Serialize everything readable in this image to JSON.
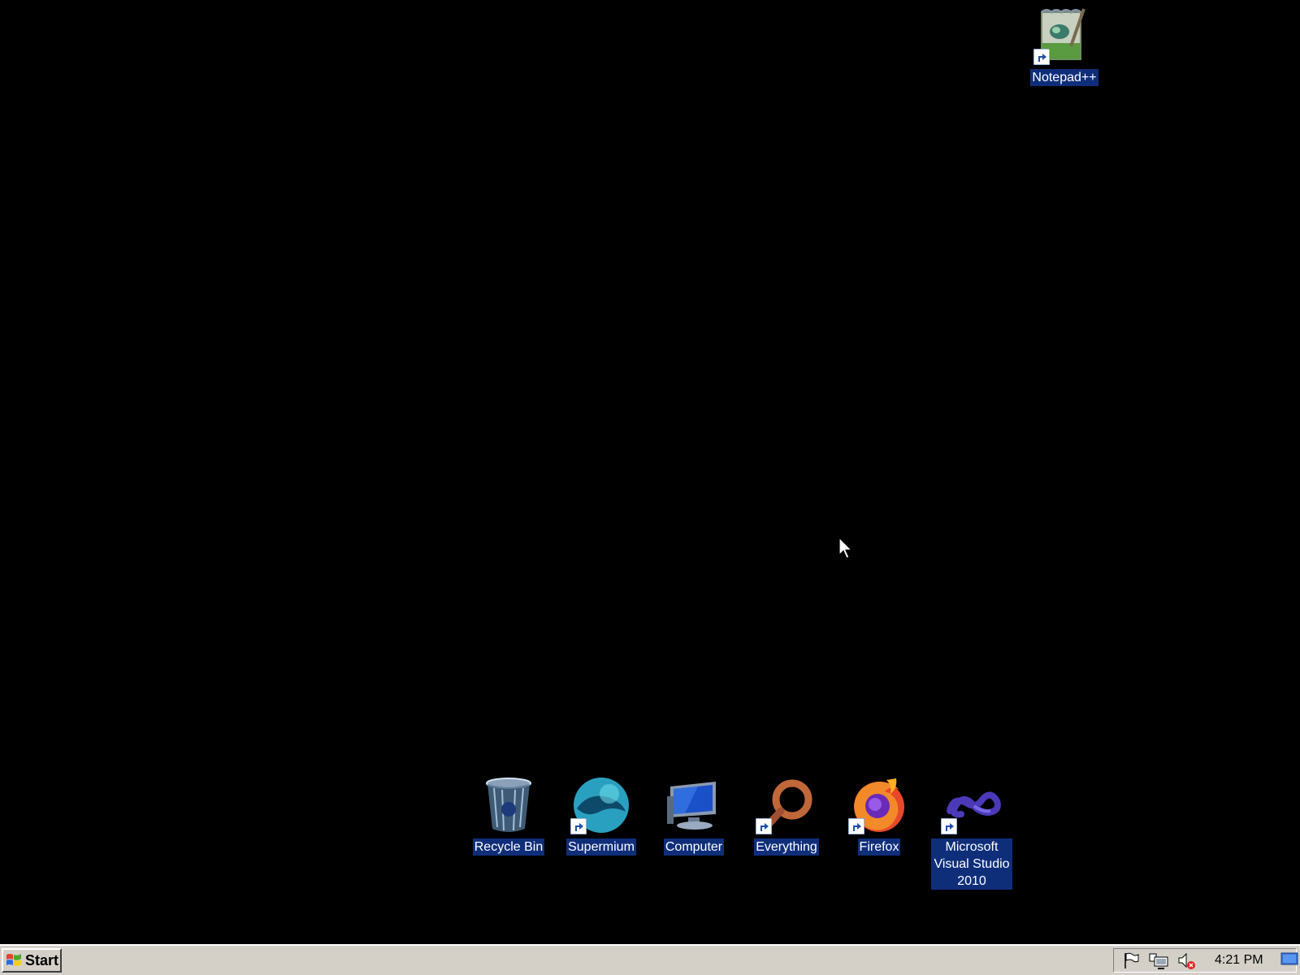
{
  "desktop": {
    "background_color": "#000000",
    "label_highlight_color": "#0f2e7a",
    "icons": [
      {
        "label": "Notepad++",
        "icon": "notepad-plus-plus-icon",
        "shortcut": true
      },
      {
        "label": "Recycle Bin",
        "icon": "recycle-bin-icon",
        "shortcut": false
      },
      {
        "label": "Supermium",
        "icon": "supermium-icon",
        "shortcut": true
      },
      {
        "label": "Computer",
        "icon": "computer-icon",
        "shortcut": false
      },
      {
        "label": "Everything",
        "icon": "everything-icon",
        "shortcut": true
      },
      {
        "label": "Firefox",
        "icon": "firefox-icon",
        "shortcut": true
      },
      {
        "label": "Microsoft Visual Studio 2010",
        "icon": "visual-studio-icon",
        "shortcut": true
      }
    ]
  },
  "taskbar": {
    "start_label": "Start",
    "tray_icons": [
      "action-center-flag-icon",
      "network-icon",
      "volume-muted-icon"
    ],
    "clock": "4:21 PM",
    "color": "#d4d0c8"
  }
}
